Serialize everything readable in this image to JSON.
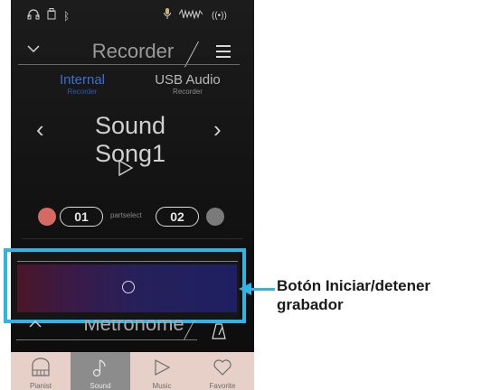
{
  "status_icons": [
    "headphones-icon",
    "usb-icon",
    "bluetooth-icon",
    "mic-icon",
    "waveform-icon",
    "wireless-icon"
  ],
  "header": {
    "title": "Recorder"
  },
  "tabs": [
    {
      "label": "Internal",
      "sub": "Recorder",
      "active": true
    },
    {
      "label": "USB Audio",
      "sub": "Recorder",
      "active": false
    }
  ],
  "song": {
    "name": "Sound Song1",
    "prev": "‹",
    "next": "›"
  },
  "parts": {
    "part1": "01",
    "select_label": "partselect",
    "part2": "02"
  },
  "callout": {
    "text": "Botón Iniciar/detener grabador"
  },
  "metronome": {
    "title": "Metronome"
  },
  "nav": [
    "Pianist",
    "Sound",
    "Music",
    "Favorite"
  ],
  "colors": {
    "accent": "#3a6fd0",
    "highlight": "#2fb4e6",
    "record_dot": "#d46a62",
    "nav_bg": "#e6d0c8"
  }
}
